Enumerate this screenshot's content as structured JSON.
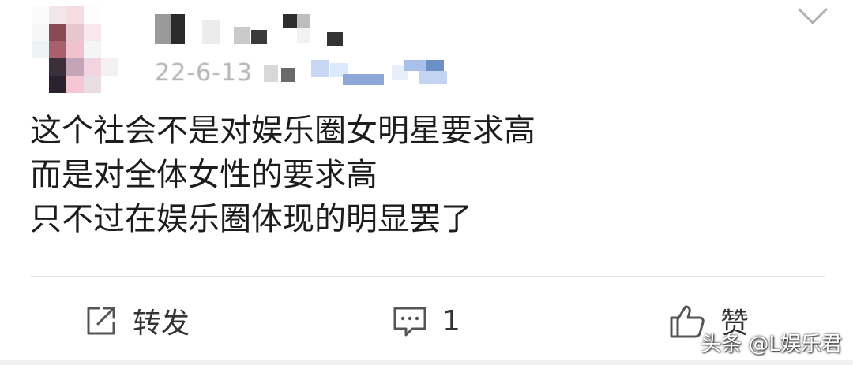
{
  "post": {
    "author": {
      "avatar_icon": "avatar-mosaic",
      "username": "",
      "date": "22-6-13",
      "source": ""
    },
    "menu_icon": "chevron-down-icon",
    "content": {
      "lines": [
        "这个社会不是对娱乐圈女明星要求高",
        "而是对全体女性的要求高",
        "只不过在娱乐圈体现的明显罢了"
      ]
    },
    "actions": {
      "repost": {
        "icon": "repost-icon",
        "label": "转发"
      },
      "comment": {
        "icon": "comment-icon",
        "count": "1"
      },
      "like": {
        "icon": "thumbs-up-icon",
        "label": "赞"
      }
    }
  },
  "watermark": "头条 @L娱乐君",
  "colors": {
    "background": "#ffffff",
    "text": "#1c1c1c",
    "meta": "#b3b3b3",
    "divider": "#e6e6e6",
    "icon": "#555555"
  }
}
